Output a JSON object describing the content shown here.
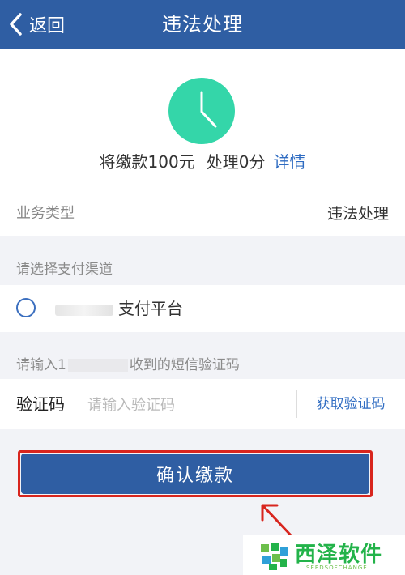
{
  "header": {
    "back_label": "返回",
    "title": "违法处理"
  },
  "summary": {
    "fine_text": "将缴款100元",
    "points_text": "处理0分",
    "details_link": "详情",
    "clock_color": "#34d6a9"
  },
  "business": {
    "label": "业务类型",
    "value": "违法处理"
  },
  "payment": {
    "section_label": "请选择支付渠道",
    "channel_label": "支付平台"
  },
  "sms": {
    "hint_prefix": "请输入1",
    "hint_suffix": "收到的短信验证码"
  },
  "verification": {
    "label": "验证码",
    "placeholder": "请输入验证码",
    "get_code_label": "获取验证码"
  },
  "confirm": {
    "label": "确认缴款"
  },
  "watermark": {
    "brand": "西泽软件",
    "sub": "SEEDSOFCHANGE"
  },
  "colors": {
    "primary": "#2f5ea3",
    "link": "#2f6cc2",
    "highlight": "#d8251e"
  }
}
